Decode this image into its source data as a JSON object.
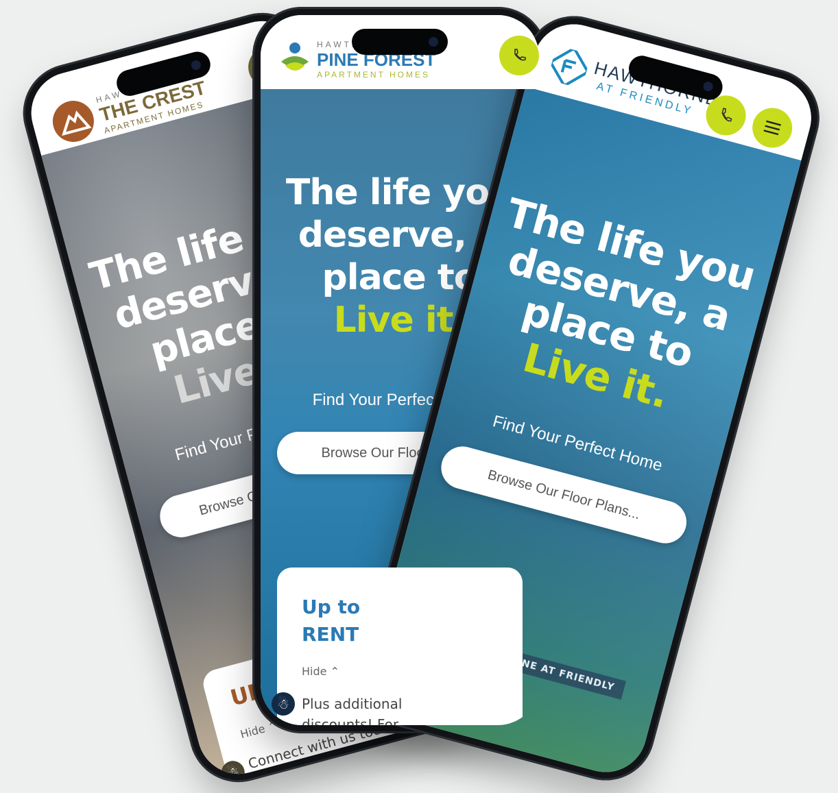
{
  "phones": {
    "crest": {
      "brand_small": "HAWTHORNE",
      "brand_main": "THE CREST",
      "brand_sub": "APARTMENT HOMES",
      "headline": [
        "The life you",
        "deserve, a",
        "place to",
        "Live it."
      ],
      "subhead": "Find Your Perfect Home",
      "browse": "Browse Our Floor Plans...",
      "card_title": "UP TO",
      "hide": "Hide",
      "card_body": "Connect with us today",
      "accent": "#a65a2a"
    },
    "pine": {
      "brand_small": "HAWTHORNE",
      "brand_main": "PINE FOREST",
      "brand_sub": "APARTMENT HOMES",
      "headline": [
        "The life you",
        "deserve, a",
        "place to",
        "Live it."
      ],
      "subhead": "Find Your Perfect Home",
      "browse": "Browse Our Floor Plans...",
      "card_title": [
        "Up to",
        "RENT"
      ],
      "hide": "Hide",
      "card_body": [
        "Plus additional",
        "discounts! For"
      ],
      "accent": "#2a7ab5"
    },
    "friendly": {
      "brand_small": "HAWTHORNE",
      "brand_main": "AT FRIENDLY",
      "headline": [
        "The life you",
        "deserve, a",
        "place to",
        "Live it."
      ],
      "subhead": "Find Your Perfect Home",
      "browse": "Browse Our Floor Plans...",
      "sign": "HAWTHORNE AT FRIENDLY",
      "accent": "#c8dc1e"
    }
  },
  "icons": [
    "phone-icon",
    "menu-icon",
    "accessibility-icon",
    "chevron-up-icon"
  ]
}
